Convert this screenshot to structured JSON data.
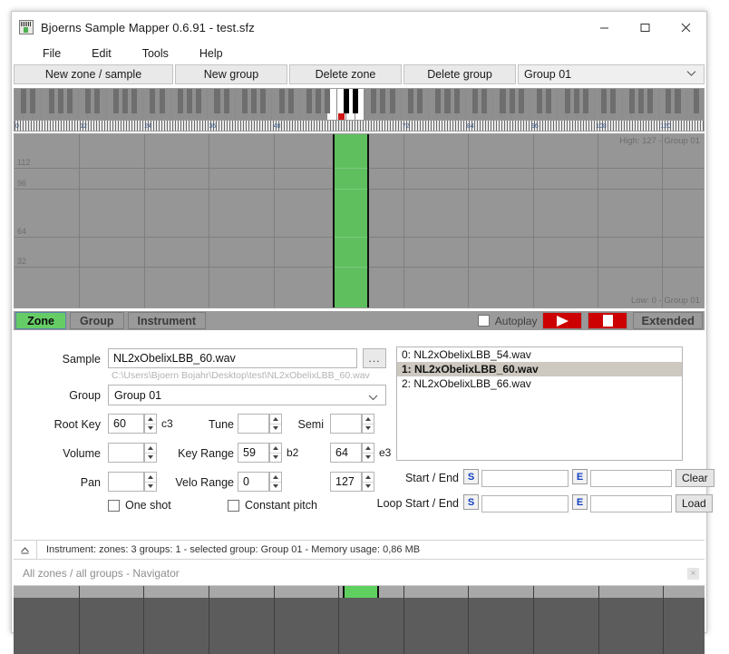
{
  "window": {
    "title": "Bjoerns Sample Mapper 0.6.91 - test.sfz",
    "icon": "sample-mapper-icon",
    "minimize": "–",
    "maximize": "□",
    "close": "✕"
  },
  "menu": [
    {
      "label": "File"
    },
    {
      "label": "Edit"
    },
    {
      "label": "Tools"
    },
    {
      "label": "Help"
    }
  ],
  "toolbar": {
    "new_zone_sample": "New zone / sample",
    "new_group": "New group",
    "delete_zone": "Delete zone",
    "delete_group": "Delete group",
    "group_selected": "Group 01",
    "group_chevron": "chevron-down-icon"
  },
  "keyboard": {
    "ruler_labels": [
      "0",
      "12",
      "24",
      "36",
      "48",
      "72",
      "84",
      "96",
      "108",
      "120"
    ],
    "active_low": 59,
    "active_high": 64,
    "root_key": 60
  },
  "map": {
    "y_labels": [
      "112",
      "96",
      "64",
      "32"
    ],
    "high_label": "High: 127 - Group 01",
    "low_label": "Low: 0 - Group 01",
    "zone_color": "#5fbf5f"
  },
  "tabs": [
    {
      "label": "Zone",
      "active": true
    },
    {
      "label": "Group",
      "active": false
    },
    {
      "label": "Instrument",
      "active": false
    }
  ],
  "transport": {
    "autoplay_label": "Autoplay",
    "autoplay_checked": false,
    "play_icon": "play-icon",
    "stop_icon": "stop-icon",
    "extended_label": "Extended"
  },
  "zone_editor": {
    "sample_label": "Sample",
    "sample_value": "NL2xObelixLBB_60.wav",
    "browse_label": "...",
    "sample_path": "C:\\Users\\Bjoern Bojahr\\Desktop\\test\\NL2xObelixLBB_60.wav",
    "group_label": "Group",
    "group_value": "Group 01",
    "root_key_label": "Root Key",
    "root_key_value": "60",
    "root_key_note": "c3",
    "tune_label": "Tune",
    "tune_value": "",
    "semi_label": "Semi",
    "semi_value": "",
    "volume_label": "Volume",
    "volume_value": "",
    "key_range_label": "Key Range",
    "key_range_low": "59",
    "key_range_low_note": "b2",
    "key_range_high": "64",
    "key_range_high_note": "e3",
    "pan_label": "Pan",
    "pan_value": "",
    "velo_range_label": "Velo Range",
    "velo_range_low": "0",
    "velo_range_high": "127",
    "one_shot_label": "One shot",
    "one_shot_checked": false,
    "constant_pitch_label": "Constant pitch",
    "constant_pitch_checked": false
  },
  "sample_list": {
    "items": [
      {
        "label": "0: NL2xObelixLBB_54.wav",
        "selected": false
      },
      {
        "label": "1: NL2xObelixLBB_60.wav",
        "selected": true
      },
      {
        "label": "2: NL2xObelixLBB_66.wav",
        "selected": false
      }
    ]
  },
  "markers": {
    "start_end_label": "Start / End",
    "loop_start_end_label": "Loop Start / End",
    "s_badge": "S",
    "e_badge": "E",
    "start_value": "",
    "end_value": "",
    "loop_start_value": "",
    "loop_end_value": "",
    "clear_label": "Clear",
    "load_label": "Load"
  },
  "status": {
    "collapse_icon": "chevron-up-icon",
    "text": "Instrument:   zones: 3  groups: 1    -    selected group: Group 01    -    Memory usage: 0,86 MB"
  },
  "navigator": {
    "title": "All zones / all groups - Navigator",
    "close_icon": "close-icon",
    "close_label": "×"
  }
}
